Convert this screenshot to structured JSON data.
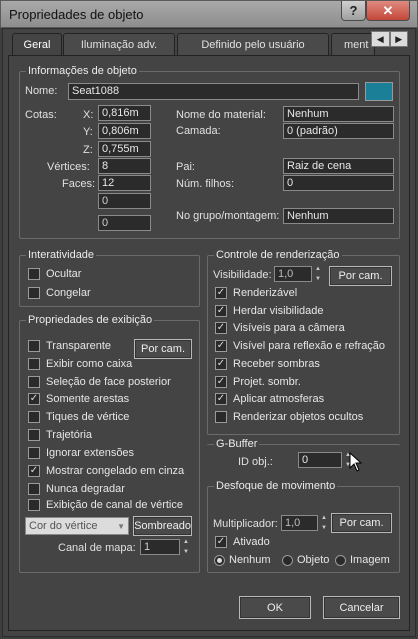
{
  "window": {
    "title": "Propriedades de objeto",
    "help": "?",
    "close": "✕"
  },
  "tabs": [
    {
      "label": "Geral"
    },
    {
      "label": "Iluminação adv."
    },
    {
      "label": "Definido pelo usuário"
    },
    {
      "label": "ment"
    }
  ],
  "info": {
    "title": "Informações de objeto",
    "name_label": "Nome:",
    "name_value": "Seat1088",
    "color_swatch": "#1c7f98",
    "dims_label": "Cotas:",
    "x_label": "X:",
    "x_value": "0,816m",
    "y_label": "Y:",
    "y_value": "0,806m",
    "z_label": "Z:",
    "z_value": "0,755m",
    "vertices_label": "Vértices:",
    "vertices_value": "8",
    "faces_label": "Faces:",
    "faces_value": "12",
    "extra1": "0",
    "extra2": "0",
    "material_label": "Nome do material:",
    "material_value": "Nenhum",
    "layer_label": "Camada:",
    "layer_value": "0 (padrão)",
    "parent_label": "Pai:",
    "parent_value": "Raiz de cena",
    "children_label": "Núm. filhos:",
    "children_value": "0",
    "group_label": "No grupo/montagem:",
    "group_value": "Nenhum"
  },
  "interactivity": {
    "title": "Interatividade",
    "items": [
      {
        "label": "Ocultar",
        "checked": false
      },
      {
        "label": "Congelar",
        "checked": false
      }
    ]
  },
  "display": {
    "title": "Propriedades de exibição",
    "by_cam": "Por cam.",
    "items": [
      {
        "label": "Transparente",
        "checked": false
      },
      {
        "label": "Exibir como caixa",
        "checked": false
      },
      {
        "label": "Seleção de face posterior",
        "checked": false
      },
      {
        "label": "Somente arestas",
        "checked": true
      },
      {
        "label": "Tiques de vértice",
        "checked": false
      },
      {
        "label": "Trajetória",
        "checked": false
      },
      {
        "label": "Ignorar extensões",
        "checked": false
      },
      {
        "label": "Mostrar congelado em cinza",
        "checked": true
      },
      {
        "label": "Nunca degradar",
        "checked": false
      },
      {
        "label": "Exibição de canal de vértice",
        "checked": false
      }
    ],
    "color_select": "Cor do vértice",
    "shaded_btn": "Sombreado",
    "map_channel_label": "Canal de mapa:",
    "map_channel_value": "1"
  },
  "render": {
    "title": "Controle de renderização",
    "visibility_label": "Visibilidade:",
    "visibility_value": "1,0",
    "by_cam": "Por cam.",
    "items": [
      {
        "label": "Renderizável",
        "checked": true
      },
      {
        "label": "Herdar visibilidade",
        "checked": true
      },
      {
        "label": "Visíveis para a câmera",
        "checked": true
      },
      {
        "label": "Visível para reflexão e refração",
        "checked": true
      },
      {
        "label": "Receber sombras",
        "checked": true
      },
      {
        "label": "Projet. sombr.",
        "checked": true
      },
      {
        "label": "Aplicar atmosferas",
        "checked": true
      },
      {
        "label": "Renderizar objetos ocultos",
        "checked": false
      }
    ]
  },
  "gbuffer": {
    "title": "G-Buffer",
    "id_label": "ID obj.:",
    "id_value": "0"
  },
  "motion": {
    "title": "Desfoque de movimento",
    "mult_label": "Multiplicador:",
    "mult_value": "1,0",
    "by_cam": "Por cam.",
    "enabled_label": "Ativado",
    "enabled_checked": true,
    "options": [
      {
        "label": "Nenhum",
        "selected": true
      },
      {
        "label": "Objeto",
        "selected": false
      },
      {
        "label": "Imagem",
        "selected": false
      }
    ]
  },
  "footer": {
    "ok": "OK",
    "cancel": "Cancelar"
  }
}
